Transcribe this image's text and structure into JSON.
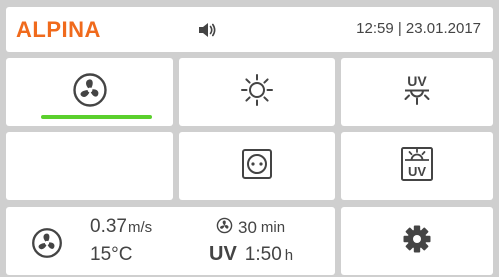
{
  "header": {
    "brand": "ALPINA",
    "datetime": "12:59 | 23.01.2017",
    "speaker_icon": "speaker-icon"
  },
  "tiles": {
    "fan": {
      "icon": "fan-icon",
      "active": true
    },
    "light": {
      "icon": "sun-icon"
    },
    "uv": {
      "icon": "uv-lamp-icon",
      "label": "UV"
    },
    "empty": {},
    "socket": {
      "icon": "power-socket-icon"
    },
    "uv_window": {
      "icon": "uv-window-icon",
      "label": "UV"
    },
    "settings": {
      "icon": "gear-icon"
    }
  },
  "status": {
    "speed_value": "0.37",
    "speed_unit": "m/s",
    "temp_value": "15",
    "temp_unit": "°C",
    "timer_value": "30",
    "timer_unit": "min",
    "uv_label": "UV",
    "uv_time_value": "1:50",
    "uv_time_unit": "h"
  },
  "colors": {
    "brand": "#f06a1c",
    "active": "#5bd02d",
    "icon": "#444444",
    "background": "#cfcfcf",
    "tile": "#ffffff"
  }
}
